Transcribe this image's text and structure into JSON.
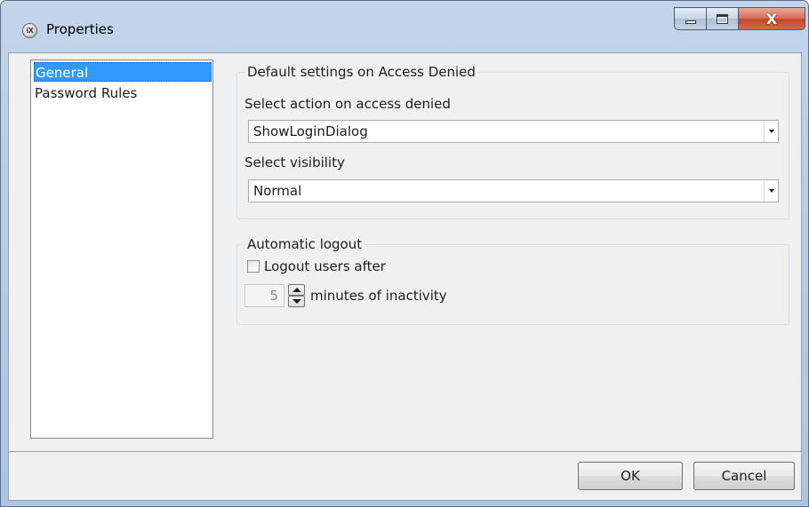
{
  "window": {
    "title": "Properties",
    "icon": "ix-app-icon",
    "icon_text": "iX",
    "caption_buttons": [
      "minimize",
      "maximize",
      "close"
    ],
    "close_glyph": "X"
  },
  "nav": {
    "items": [
      {
        "label": "General",
        "selected": true
      },
      {
        "label": "Password Rules",
        "selected": false
      }
    ]
  },
  "access_denied": {
    "group_title": "Default settings on Access Denied",
    "action_label": "Select action on access denied",
    "action_value": "ShowLoginDialog",
    "visibility_label": "Select visibility",
    "visibility_value": "Normal"
  },
  "logout": {
    "group_title": "Automatic logout",
    "checkbox_label": "Logout users after",
    "checked": false,
    "minutes_value": "5",
    "minutes_suffix": "minutes of inactivity"
  },
  "footer": {
    "ok_label": "OK",
    "cancel_label": "Cancel"
  },
  "colors": {
    "selection": "#3399ff",
    "titlebar": "#b9cde5",
    "close_button": "#c2472d",
    "panel": "#f0f0f0"
  }
}
